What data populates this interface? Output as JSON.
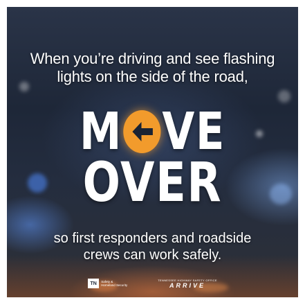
{
  "headline": {
    "line1": "When you’re driving and see flashing",
    "line2": "lights on the side of the road,"
  },
  "big_text": {
    "move_m": "M",
    "move_ve": "VE",
    "over": "OVER"
  },
  "subline": {
    "line1": "so first responders and roadside",
    "line2": "crews can work safely."
  },
  "footer": {
    "tn_badge": "TN",
    "tn_line1": "Safety &",
    "tn_line2": "Homeland Security",
    "arrive_top": "TENNESSEE HIGHWAY SAFETY OFFICE",
    "arrive_main": "ARRIVE"
  },
  "colors": {
    "accent": "#f29b2c",
    "background": "#1a2333",
    "text": "#ffffff"
  },
  "icons": {
    "o_symbol": "left-arrow-in-orange-circle-icon"
  }
}
